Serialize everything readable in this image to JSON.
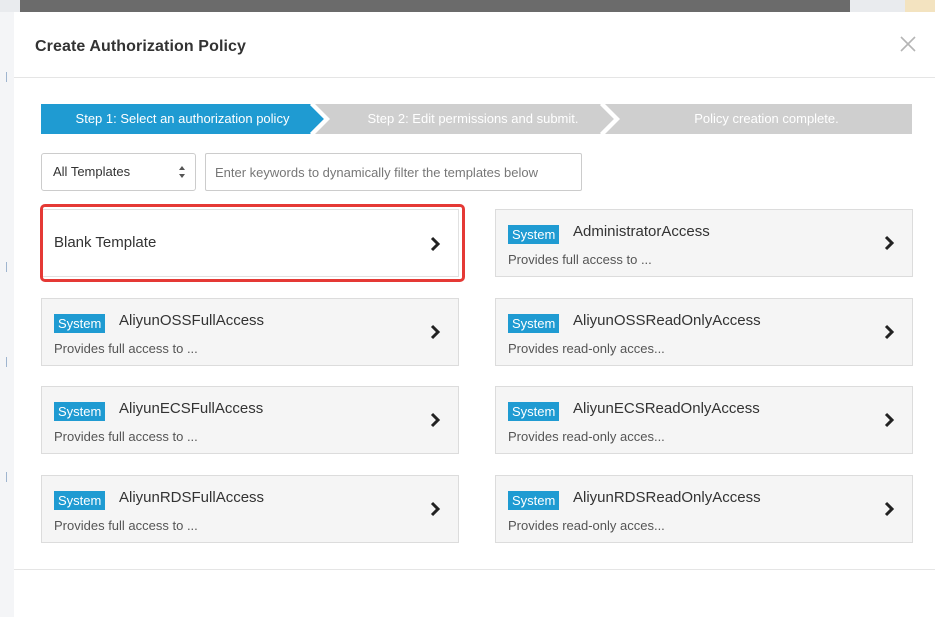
{
  "modal": {
    "title": "Create Authorization Policy"
  },
  "steps": [
    {
      "label": "Step 1: Select an authorization policy",
      "state": "active"
    },
    {
      "label": "Step 2: Edit permissions and submit.",
      "state": "inactive"
    },
    {
      "label": "Policy creation complete.",
      "state": "inactive"
    }
  ],
  "colors": {
    "step_active": "#1f9bd2",
    "step_inactive": "#cfcfcf",
    "badge": "#1f9bd2",
    "highlight": "#e53935"
  },
  "filter": {
    "select_value": "All Templates",
    "search_placeholder": "Enter keywords to dynamically filter the templates below",
    "search_value": ""
  },
  "templates": [
    {
      "name": "Blank Template",
      "badge": "",
      "desc": ""
    },
    {
      "name": "AdministratorAccess",
      "badge": "System",
      "desc": "Provides full access to ..."
    },
    {
      "name": "AliyunOSSFullAccess",
      "badge": "System",
      "desc": "Provides full access to ..."
    },
    {
      "name": "AliyunOSSReadOnlyAccess",
      "badge": "System",
      "desc": "Provides read-only acces..."
    },
    {
      "name": "AliyunECSFullAccess",
      "badge": "System",
      "desc": "Provides full access to ..."
    },
    {
      "name": "AliyunECSReadOnlyAccess",
      "badge": "System",
      "desc": "Provides read-only acces..."
    },
    {
      "name": "AliyunRDSFullAccess",
      "badge": "System",
      "desc": "Provides full access to ..."
    },
    {
      "name": "AliyunRDSReadOnlyAccess",
      "badge": "System",
      "desc": "Provides read-only acces..."
    }
  ]
}
